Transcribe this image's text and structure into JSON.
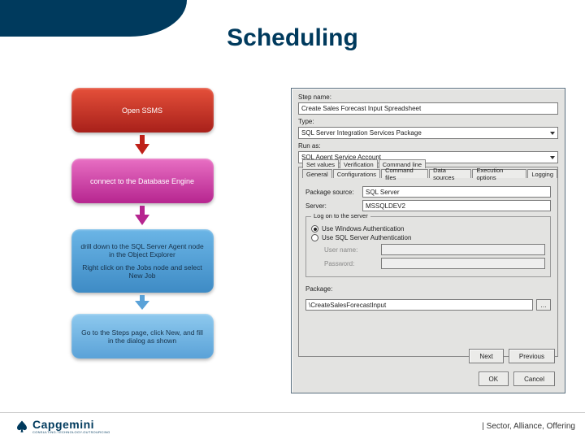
{
  "title": "Scheduling",
  "flow": {
    "step1": "Open SSMS",
    "step2": "connect to the Database Engine",
    "step3a": "drill down to the SQL Server Agent node in the Object Explorer",
    "step3b": "Right click on the Jobs node and select New Job",
    "step4": "Go to the Steps page, click New, and fill in the dialog as shown"
  },
  "dialog": {
    "stepname_label": "Step name:",
    "stepname": "Create Sales Forecast Input Spreadsheet",
    "type_label": "Type:",
    "type": "SQL Server Integration Services Package",
    "runas_label": "Run as:",
    "runas": "SQL Agent Service Account",
    "tabs": [
      "Set values",
      "Verification",
      "Command line",
      "General",
      "Configurations",
      "Command files",
      "Data sources",
      "Execution options",
      "Logging"
    ],
    "pkgsource_label": "Package source:",
    "pkgsource": "SQL Server",
    "server_label": "Server:",
    "server": "MSSQLDEV2",
    "logon_label": "Log on to the server",
    "radio1": "Use Windows Authentication",
    "radio2": "Use SQL Server Authentication",
    "user_label": "User name:",
    "pass_label": "Password:",
    "package_label": "Package:",
    "package": "\\CreateSalesForecastInput",
    "browse": "…",
    "next": "Next",
    "previous": "Previous",
    "ok": "OK",
    "cancel": "Cancel"
  },
  "footer": "| Sector, Alliance, Offering",
  "brand": {
    "name": "Capgemini",
    "tagline": "CONSULTING.TECHNOLOGY.OUTSOURCING"
  }
}
